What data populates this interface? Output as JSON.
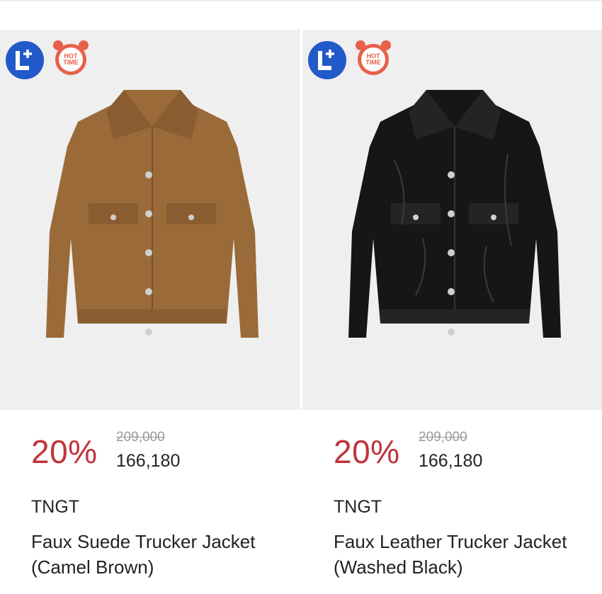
{
  "colors": {
    "accent_discount": "#c0333a",
    "lplus_badge": "#2259c8",
    "hot_badge": "#e8604a",
    "thumb_bg": "#efefef"
  },
  "badges": {
    "lplus_icon": "lplus-badge-icon",
    "hot_time_line1": "HOT",
    "hot_time_line2": "TIME"
  },
  "products": [
    {
      "discount": "20%",
      "original_price": "209,000",
      "sale_price": "166,180",
      "brand": "TNGT",
      "name_line1": "Faux Suede Trucker Jacket",
      "name_line2": "(Camel Brown)",
      "jacket_color": "#9a6a38"
    },
    {
      "discount": "20%",
      "original_price": "209,000",
      "sale_price": "166,180",
      "brand": "TNGT",
      "name_line1": "Faux Leather Trucker Jacket",
      "name_line2": "(Washed Black)",
      "jacket_color": "#161616"
    }
  ]
}
